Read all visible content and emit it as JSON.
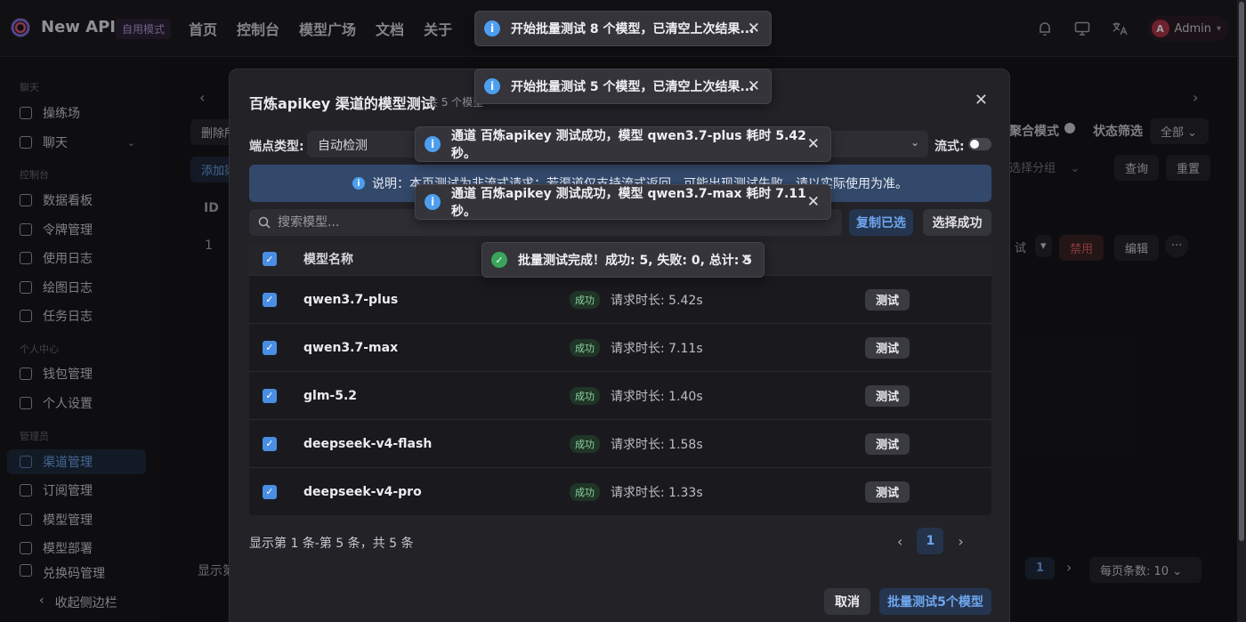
{
  "app": {
    "brand": "New API",
    "mode": "自用模式",
    "user": "Admin",
    "avatar_letter": "A"
  },
  "topnav": [
    "首页",
    "控制台",
    "模型广场",
    "文档",
    "关于"
  ],
  "sidebar": {
    "sections": {
      "chat": "聊天",
      "console": "控制台",
      "personal": "个人中心",
      "admin": "管理员"
    },
    "items": {
      "playground": "操练场",
      "chat": "聊天",
      "dashboard": "数据看板",
      "tokens": "令牌管理",
      "usage_log": "使用日志",
      "draw_log": "绘图日志",
      "task_log": "任务日志",
      "wallet": "钱包管理",
      "settings": "个人设置",
      "channels": "渠道管理",
      "subscriptions": "订阅管理",
      "models": "模型管理",
      "deploy": "模型部署",
      "redemption": "兑换码管理"
    },
    "collapse": "收起侧边栏"
  },
  "background": {
    "delete_btn": "删除所",
    "add_btn": "添加渠",
    "aggregate": "聚合模式",
    "status_filter": "状态筛选",
    "status_value": "全部",
    "group_placeholder": "选择分组",
    "query": "查询",
    "reset": "重置",
    "col_id": "ID",
    "row_id": "1",
    "row_test": "试",
    "row_disable": "禁用",
    "row_edit": "编辑",
    "footer_text": "显示第",
    "page": "1",
    "page_size": "每页条数: 10"
  },
  "modal": {
    "title": "百炼apikey 渠道的模型测试",
    "subtitle": "共 5 个模型",
    "endpoint_label": "端点类型:",
    "endpoint_value": "自动检测",
    "stream_label": "流式:",
    "notice": "说明：本页测试为非流式请求；若渠道仅支持流式返回，可能出现测试失败，请以实际使用为准。",
    "search_placeholder": "搜索模型...",
    "copy_selected": "复制已选",
    "select_success": "选择成功",
    "column_model": "模型名称",
    "status_ok": "成功",
    "test_btn": "测试",
    "rows": [
      {
        "model": "qwen3.7-plus",
        "duration": "请求时长: 5.42s"
      },
      {
        "model": "qwen3.7-max",
        "duration": "请求时长: 7.11s"
      },
      {
        "model": "glm-5.2",
        "duration": "请求时长: 1.40s"
      },
      {
        "model": "deepseek-v4-flash",
        "duration": "请求时长: 1.58s"
      },
      {
        "model": "deepseek-v4-pro",
        "duration": "请求时长: 1.33s"
      }
    ],
    "pagination_text": "显示第 1 条-第 5 条，共 5 条",
    "current_page": "1",
    "cancel": "取消",
    "batch_test": "批量测试5个模型"
  },
  "toasts": [
    {
      "text": "开始批量测试 8 个模型，已清空上次结果...",
      "type": "info"
    },
    {
      "text": "开始批量测试 5 个模型，已清空上次结果...",
      "type": "info"
    },
    {
      "text": "通道 百炼apikey 测试成功，模型 qwen3.7-plus 耗时 5.42 秒。",
      "type": "info"
    },
    {
      "text": "通道 百炼apikey 测试成功，模型 qwen3.7-max 耗时 7.11 秒。",
      "type": "info"
    },
    {
      "text": "批量测试完成！成功: 5, 失败: 0, 总计: 5",
      "type": "success"
    }
  ],
  "colors": {
    "accent": "#4a8ee4",
    "background": "#16161a",
    "success": "#3aa55a",
    "danger": "#e06060"
  }
}
